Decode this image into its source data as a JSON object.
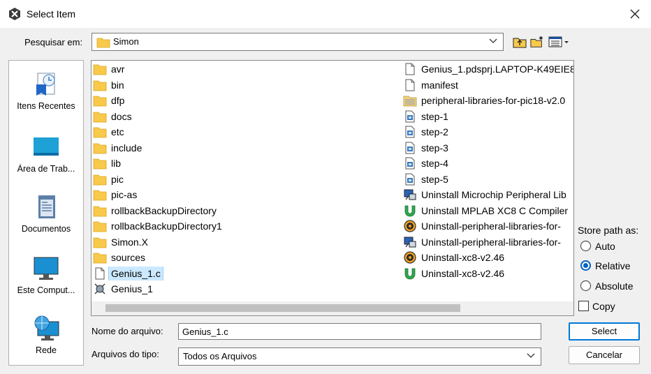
{
  "window": {
    "title": "Select Item"
  },
  "lookin": {
    "label": "Pesquisar em:",
    "value": "Simon"
  },
  "places": [
    {
      "label": "Itens Recentes",
      "icon": "recent-items-icon"
    },
    {
      "label": "Área de Trab...",
      "icon": "desktop-icon"
    },
    {
      "label": "Documentos",
      "icon": "documents-icon"
    },
    {
      "label": "Este Comput...",
      "icon": "computer-icon"
    },
    {
      "label": "Rede",
      "icon": "network-icon"
    }
  ],
  "files_left": [
    {
      "name": "avr",
      "kind": "folder"
    },
    {
      "name": "bin",
      "kind": "folder"
    },
    {
      "name": "dfp",
      "kind": "folder"
    },
    {
      "name": "docs",
      "kind": "folder"
    },
    {
      "name": "etc",
      "kind": "folder"
    },
    {
      "name": "include",
      "kind": "folder"
    },
    {
      "name": "lib",
      "kind": "folder"
    },
    {
      "name": "pic",
      "kind": "folder"
    },
    {
      "name": "pic-as",
      "kind": "folder"
    },
    {
      "name": "rollbackBackupDirectory",
      "kind": "folder"
    },
    {
      "name": "rollbackBackupDirectory1",
      "kind": "folder"
    },
    {
      "name": "Simon.X",
      "kind": "folder"
    },
    {
      "name": "sources",
      "kind": "folder"
    },
    {
      "name": "Genius_1.c",
      "kind": "file"
    },
    {
      "name": "Genius_1",
      "kind": "exe"
    }
  ],
  "files_right": [
    {
      "name": "Genius_1.pdsprj.LAPTOP-K49EIE8.",
      "kind": "file"
    },
    {
      "name": "manifest",
      "kind": "file"
    },
    {
      "name": "peripheral-libraries-for-pic18-v2.0",
      "kind": "archive"
    },
    {
      "name": "step-1",
      "kind": "image"
    },
    {
      "name": "step-2",
      "kind": "image"
    },
    {
      "name": "step-3",
      "kind": "image"
    },
    {
      "name": "step-4",
      "kind": "image"
    },
    {
      "name": "step-5",
      "kind": "image"
    },
    {
      "name": "Uninstall Microchip Peripheral Lib",
      "kind": "uninstall-blue"
    },
    {
      "name": "Uninstall MPLAB XC8 C Compiler",
      "kind": "uninstall-green"
    },
    {
      "name": "Uninstall-peripheral-libraries-for-",
      "kind": "uninstall-gear"
    },
    {
      "name": "Uninstall-peripheral-libraries-for-",
      "kind": "uninstall-blue"
    },
    {
      "name": "Uninstall-xc8-v2.46",
      "kind": "uninstall-gear"
    },
    {
      "name": "Uninstall-xc8-v2.46",
      "kind": "uninstall-green"
    }
  ],
  "selected_file": "Genius_1.c",
  "filename": {
    "label": "Nome do arquivo:",
    "value": "Genius_1.c"
  },
  "filetype": {
    "label": "Arquivos do tipo:",
    "value": "Todos os Arquivos"
  },
  "store_path": {
    "label": "Store path as:",
    "options": [
      "Auto",
      "Relative",
      "Absolute"
    ],
    "selected": "Relative"
  },
  "copy_label": "Copy",
  "buttons": {
    "select": "Select",
    "cancel": "Cancelar"
  }
}
